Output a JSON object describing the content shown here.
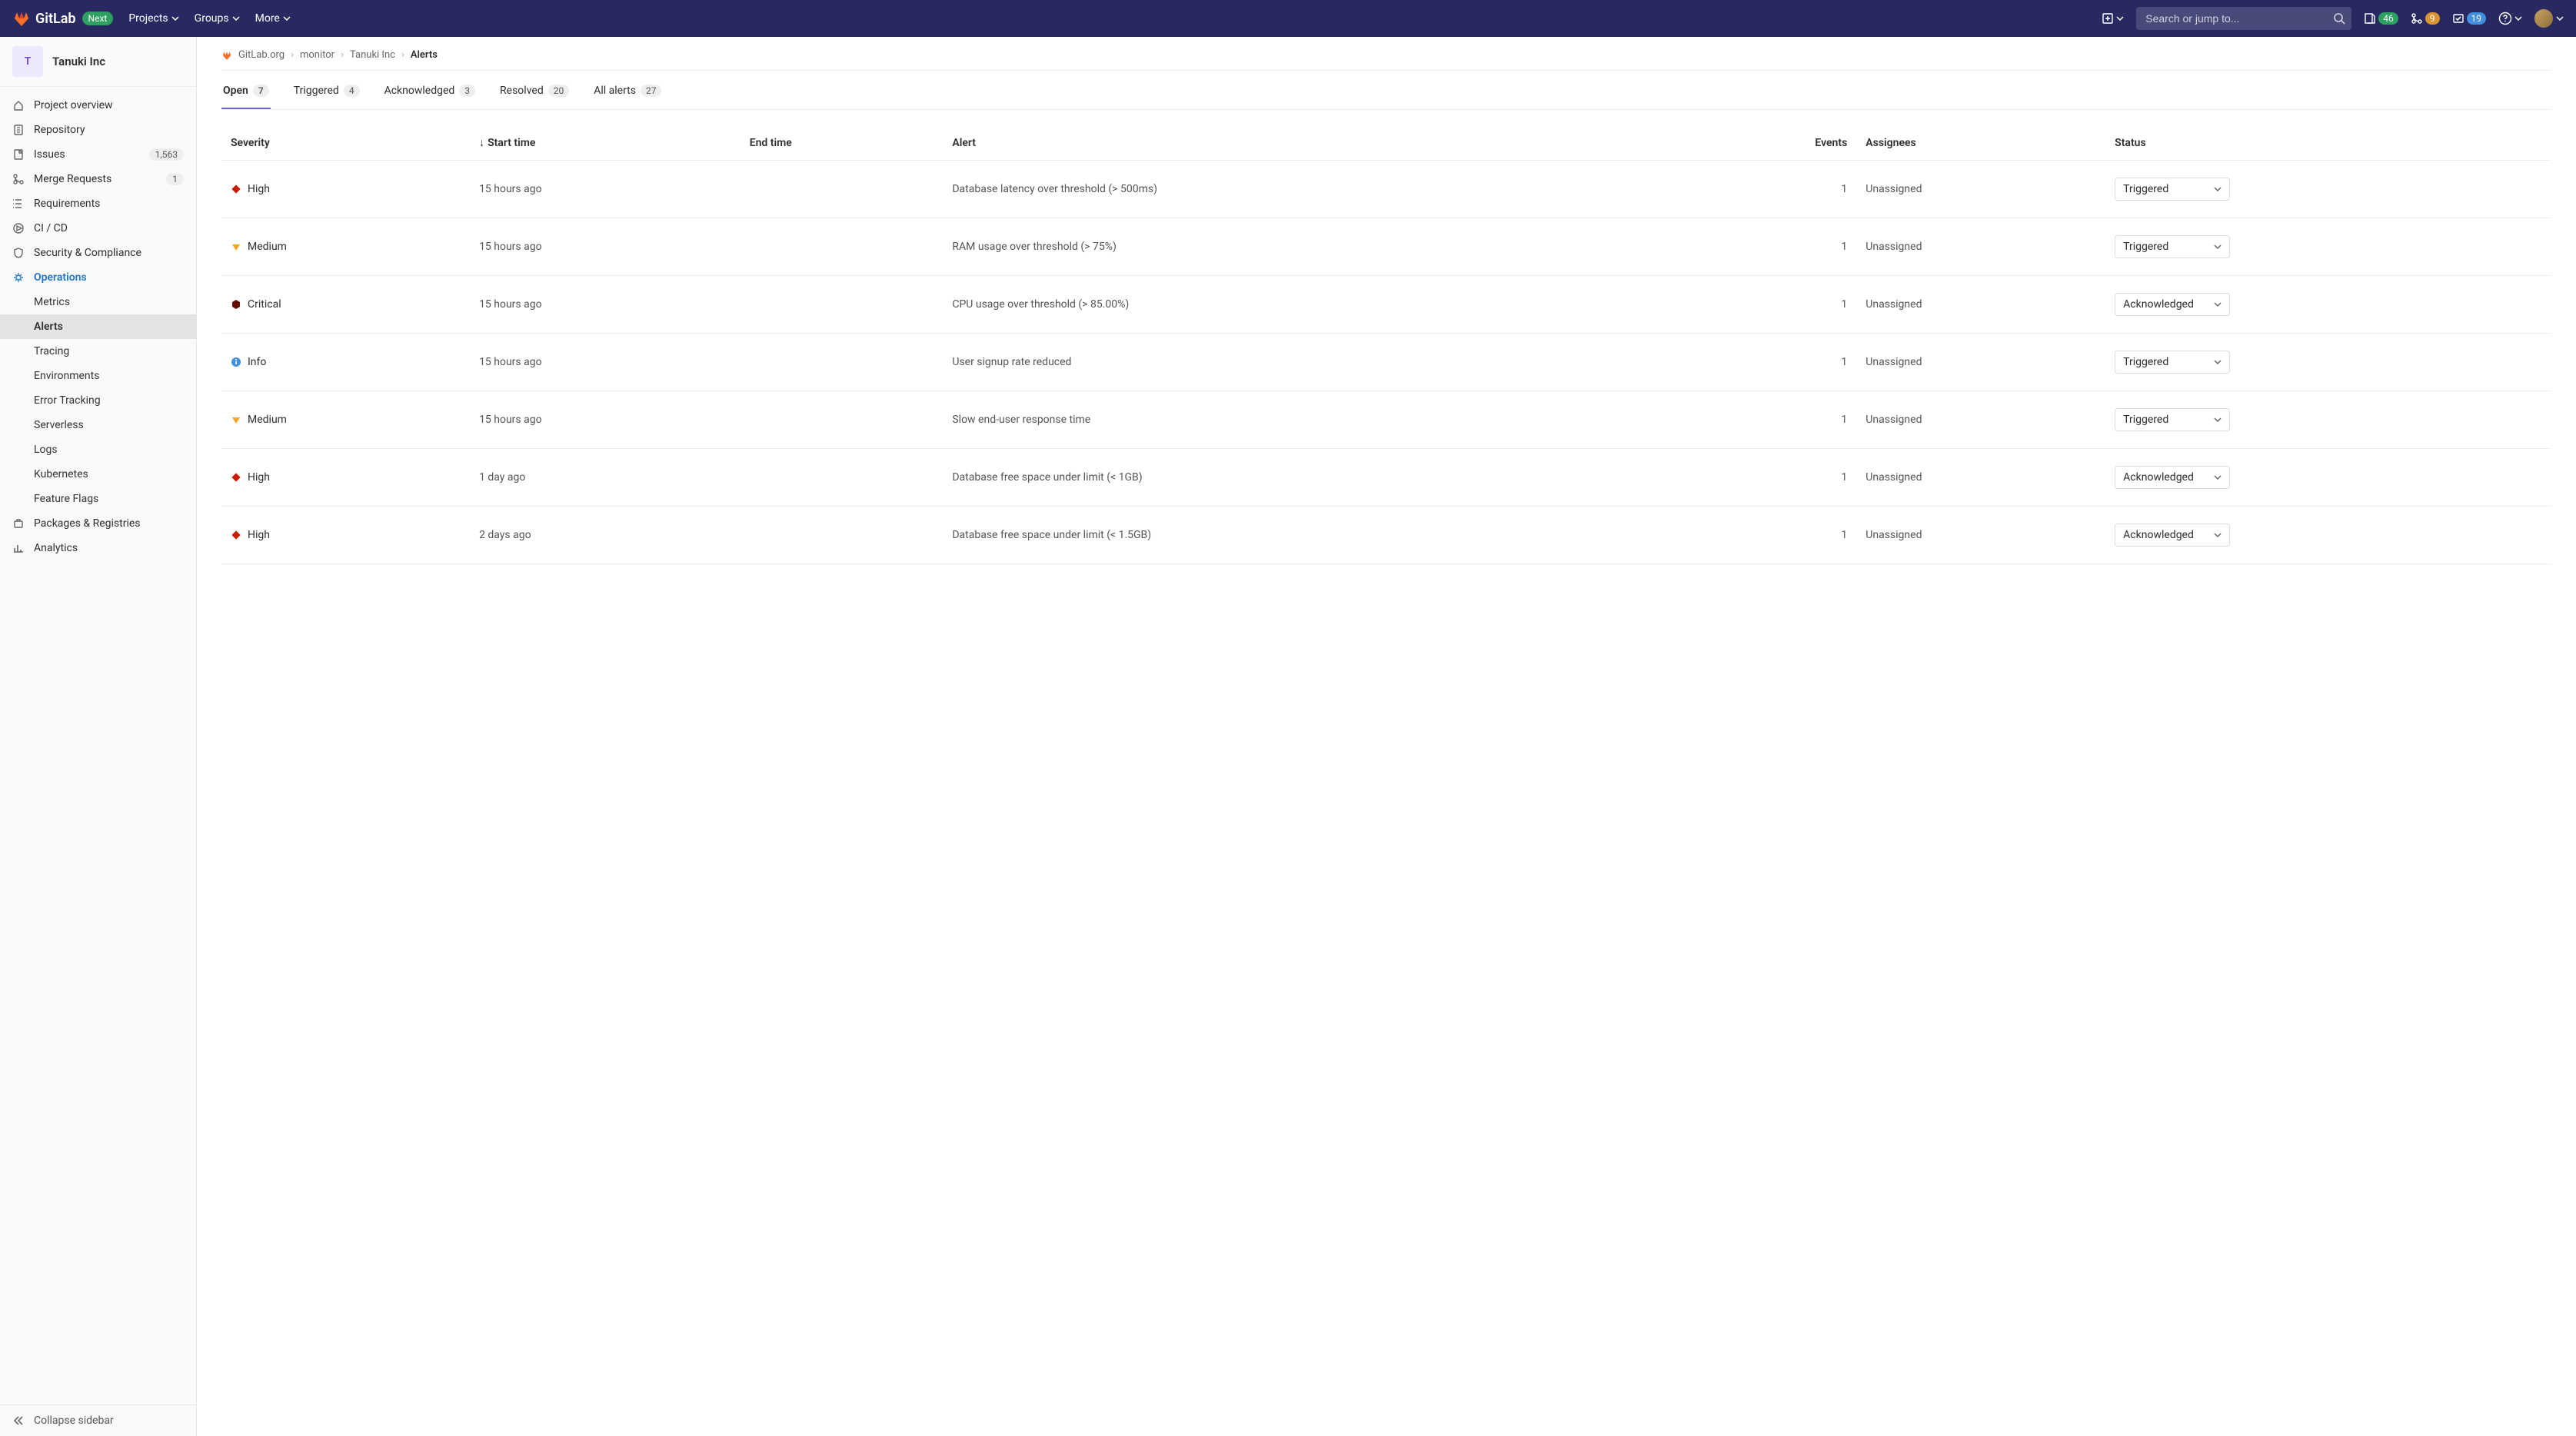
{
  "topbar": {
    "brand": "GitLab",
    "next_badge": "Next",
    "nav": [
      "Projects",
      "Groups",
      "More"
    ],
    "search_placeholder": "Search or jump to...",
    "counts": {
      "changes": "46",
      "merge": "9",
      "todo": "19"
    }
  },
  "sidebar": {
    "project_initial": "T",
    "project_name": "Tanuki Inc",
    "items": [
      {
        "label": "Project overview"
      },
      {
        "label": "Repository"
      },
      {
        "label": "Issues",
        "count": "1,563"
      },
      {
        "label": "Merge Requests",
        "count": "1"
      },
      {
        "label": "Requirements"
      },
      {
        "label": "CI / CD"
      },
      {
        "label": "Security & Compliance"
      },
      {
        "label": "Operations"
      },
      {
        "label": "Packages & Registries"
      },
      {
        "label": "Analytics"
      }
    ],
    "operations_sub": [
      "Metrics",
      "Alerts",
      "Tracing",
      "Environments",
      "Error Tracking",
      "Serverless",
      "Logs",
      "Kubernetes",
      "Feature Flags"
    ],
    "collapse": "Collapse sidebar"
  },
  "breadcrumbs": [
    "GitLab.org",
    "monitor",
    "Tanuki Inc",
    "Alerts"
  ],
  "tabs": [
    {
      "label": "Open",
      "count": "7"
    },
    {
      "label": "Triggered",
      "count": "4"
    },
    {
      "label": "Acknowledged",
      "count": "3"
    },
    {
      "label": "Resolved",
      "count": "20"
    },
    {
      "label": "All alerts",
      "count": "27"
    }
  ],
  "columns": {
    "severity": "Severity",
    "start": "Start time",
    "end": "End time",
    "alert": "Alert",
    "events": "Events",
    "assignees": "Assignees",
    "status": "Status"
  },
  "rows": [
    {
      "severity": "High",
      "start": "15 hours ago",
      "end": "",
      "alert": "Database latency over threshold (> 500ms)",
      "events": "1",
      "assignees": "Unassigned",
      "status": "Triggered"
    },
    {
      "severity": "Medium",
      "start": "15 hours ago",
      "end": "",
      "alert": "RAM usage over threshold (> 75%)",
      "events": "1",
      "assignees": "Unassigned",
      "status": "Triggered"
    },
    {
      "severity": "Critical",
      "start": "15 hours ago",
      "end": "",
      "alert": "CPU usage over threshold (> 85.00%)",
      "events": "1",
      "assignees": "Unassigned",
      "status": "Acknowledged"
    },
    {
      "severity": "Info",
      "start": "15 hours ago",
      "end": "",
      "alert": "User signup rate reduced",
      "events": "1",
      "assignees": "Unassigned",
      "status": "Triggered"
    },
    {
      "severity": "Medium",
      "start": "15 hours ago",
      "end": "",
      "alert": "Slow end-user response time",
      "events": "1",
      "assignees": "Unassigned",
      "status": "Triggered"
    },
    {
      "severity": "High",
      "start": "1 day ago",
      "end": "",
      "alert": "Database free space under limit (< 1GB)",
      "events": "1",
      "assignees": "Unassigned",
      "status": "Acknowledged"
    },
    {
      "severity": "High",
      "start": "2 days ago",
      "end": "",
      "alert": "Database free space under limit (< 1.5GB)",
      "events": "1",
      "assignees": "Unassigned",
      "status": "Acknowledged"
    }
  ]
}
